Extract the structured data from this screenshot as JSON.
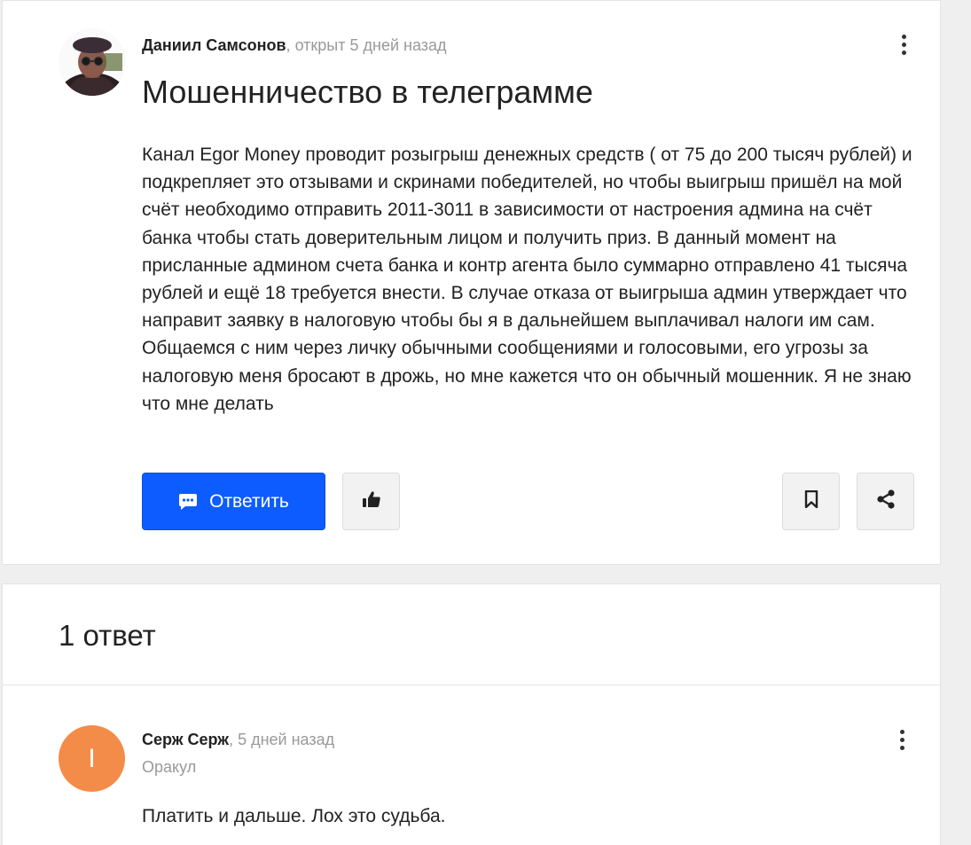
{
  "question": {
    "author": "Даниил Самсонов",
    "separator": ",",
    "opened": "открыт 5 дней назад",
    "title": "Мошенничество в телеграмме",
    "body": "Канал Egor Money проводит розыгрыш денежных средств ( от 75 до 200 тысяч рублей) и подкрепляет это отзывами и скринами победителей, но чтобы выигрыш пришёл на мой счёт необходимо отправить 2011-3011 в зависимости от настроения админа на счёт банка чтобы стать доверительным лицом и получить приз. В данный момент на присланные админом счета банка и контр агента было суммарно отправлено 41 тысяча рублей и ещё 18 требуется внести. В случае отказа от выигрыша админ утверждает что направит заявку в налоговую чтобы бы я в дальнейшем выплачивал налоги им сам. Общаемся с ним через личку обычными сообщениями и голосовыми, его угрозы за налоговую меня бросают в дрожь, но мне кажется что он обычный мошенник. Я не знаю что мне делать",
    "reply_label": "Ответить",
    "icons": {
      "reply": "comment-dots-icon",
      "like": "thumbs-up-icon",
      "bookmark": "bookmark-icon",
      "share": "share-icon",
      "menu": "kebab-menu-icon"
    }
  },
  "answers": {
    "heading": "1 ответ",
    "items": [
      {
        "author": "Серж Серж",
        "separator": ",",
        "time": "5 дней назад",
        "role": "Оракул",
        "avatar_letter": "I",
        "avatar_color": "#f38c48",
        "body": "Платить и дальше. Лох это судьба."
      }
    ]
  },
  "colors": {
    "accent": "#0c5cff",
    "muted": "#999999",
    "background": "#efefef"
  }
}
